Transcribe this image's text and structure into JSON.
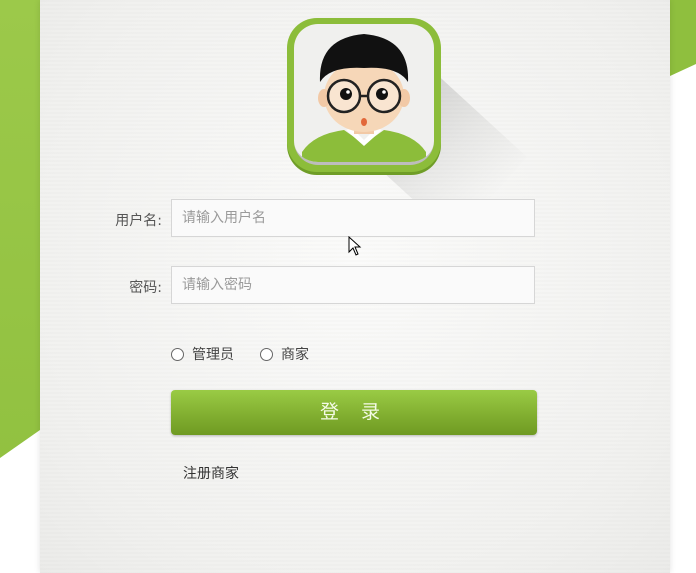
{
  "form": {
    "username_label": "用户名:",
    "username_placeholder": "请输入用户名",
    "password_label": "密码:",
    "password_placeholder": "请输入密码",
    "roles": [
      {
        "label": "管理员"
      },
      {
        "label": "商家"
      }
    ],
    "login_label": "登 录",
    "register_label": "注册商家"
  },
  "colors": {
    "accent": "#8cbd3a",
    "button_top": "#9acb45",
    "button_bottom": "#6f9a22"
  },
  "icons": {
    "avatar": "cartoon-avatar-icon"
  }
}
